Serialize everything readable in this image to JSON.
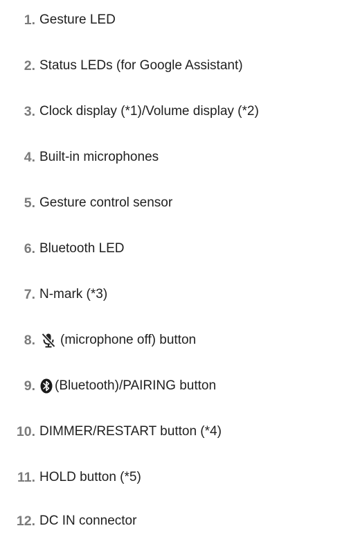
{
  "items": [
    {
      "num": "1.",
      "text": "Gesture LED"
    },
    {
      "num": "2.",
      "text": "Status LEDs (for Google Assistant)"
    },
    {
      "num": "3.",
      "text": "Clock display (*1)/Volume display (*2)"
    },
    {
      "num": "4.",
      "text": "Built-in microphones"
    },
    {
      "num": "5.",
      "text": "Gesture control sensor"
    },
    {
      "num": "6.",
      "text": "Bluetooth LED"
    },
    {
      "num": "7.",
      "text": "N-mark (*3)"
    },
    {
      "num": "8.",
      "icon": "microphone-off-icon",
      "text": "(microphone off) button"
    },
    {
      "num": "9.",
      "icon": "bluetooth-icon",
      "text": "(Bluetooth)/PAIRING button"
    },
    {
      "num": "10.",
      "text": "DIMMER/RESTART button (*4)"
    },
    {
      "num": "11.",
      "text": "HOLD button (*5)"
    },
    {
      "num": "12.",
      "text": "DC IN connector"
    }
  ]
}
